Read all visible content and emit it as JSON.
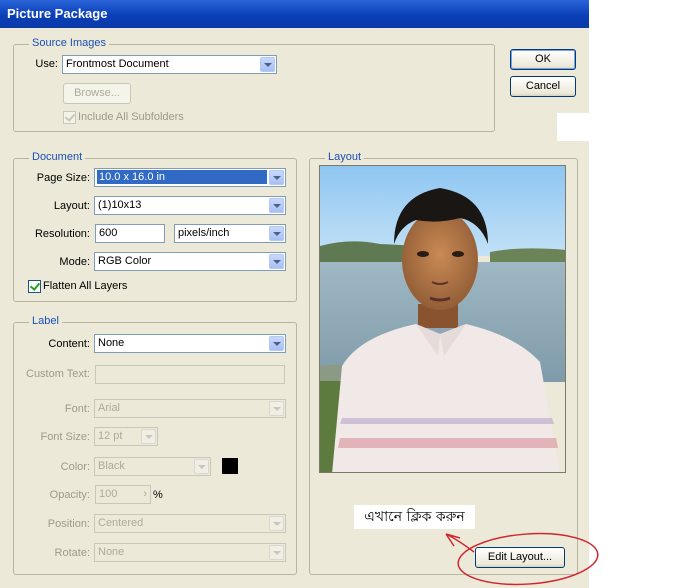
{
  "title": "Picture Package",
  "buttons": {
    "ok": "OK",
    "cancel": "Cancel",
    "browse": "Browse...",
    "edit_layout": "Edit Layout..."
  },
  "source_images": {
    "legend": "Source Images",
    "use_label": "Use:",
    "use_value": "Frontmost Document",
    "include_subfolders": "Include All Subfolders"
  },
  "document": {
    "legend": "Document",
    "page_size_label": "Page Size:",
    "page_size_value": "10.0 x 16.0 in",
    "layout_label": "Layout:",
    "layout_value": "(1)10x13",
    "resolution_label": "Resolution:",
    "resolution_value": "600",
    "resolution_unit": "pixels/inch",
    "mode_label": "Mode:",
    "mode_value": "RGB Color",
    "flatten_label": "Flatten All Layers"
  },
  "label": {
    "legend": "Label",
    "content_label": "Content:",
    "content_value": "None",
    "custom_text_label": "Custom Text:",
    "custom_text_value": "",
    "font_label": "Font:",
    "font_value": "Arial",
    "font_size_label": "Font Size:",
    "font_size_value": "12 pt",
    "color_label": "Color:",
    "color_value": "Black",
    "color_swatch": "#000000",
    "opacity_label": "Opacity:",
    "opacity_value": "100",
    "opacity_unit": "%",
    "position_label": "Position:",
    "position_value": "Centered",
    "rotate_label": "Rotate:",
    "rotate_value": "None"
  },
  "layout_panel": {
    "legend": "Layout",
    "annotation": "এখানে ক্লিক করুন"
  },
  "colors": {
    "title_bar": "#0a3fb8",
    "dialog_bg": "#ece9d8",
    "legend_text": "#1b4fb8",
    "annotation_circle": "#d0262e"
  }
}
